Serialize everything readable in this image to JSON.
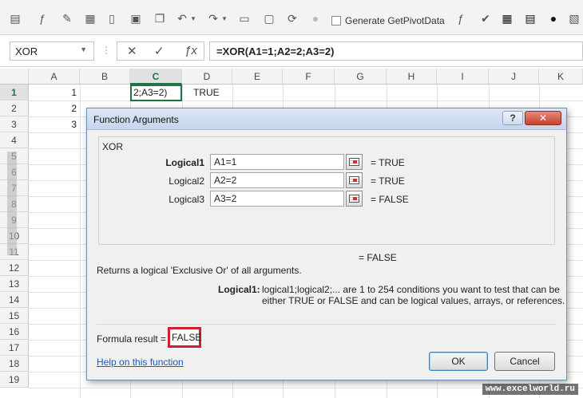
{
  "toolbar": {
    "generate_pivot_label": "Generate GetPivotData"
  },
  "formula_bar": {
    "name_box": "XOR",
    "formula": "=XOR(A1=1;A2=2;A3=2)"
  },
  "grid": {
    "columns": [
      "A",
      "B",
      "C",
      "D",
      "E",
      "F",
      "G",
      "H",
      "I",
      "J",
      "K"
    ],
    "rows": [
      "1",
      "2",
      "3",
      "4",
      "5",
      "6",
      "7",
      "8",
      "9",
      "10",
      "11",
      "12",
      "13",
      "14",
      "15",
      "16",
      "17",
      "18",
      "19"
    ],
    "cells": {
      "A1": "1",
      "A2": "2",
      "A3": "3",
      "C1": "2;A3=2)",
      "D1": "TRUE"
    }
  },
  "dialog": {
    "title": "Function Arguments",
    "help_button": "?",
    "close_button": "✕",
    "function_name": "XOR",
    "args": [
      {
        "label": "Logical1",
        "value": "A1=1",
        "result": "=  TRUE"
      },
      {
        "label": "Logical2",
        "value": "A2=2",
        "result": "=  TRUE"
      },
      {
        "label": "Logical3",
        "value": "A3=2",
        "result": "=  FALSE"
      }
    ],
    "overall_result": "=  FALSE",
    "description": "Returns a logical 'Exclusive Or' of all arguments.",
    "arg_help_label": "Logical1:",
    "arg_help_line1": "logical1;logical2;... are 1 to 254 conditions you want to test that can be",
    "arg_help_line2": "either TRUE or FALSE and can be logical values, arrays, or references.",
    "formula_result_label": "Formula result =",
    "formula_result_value": "FALSE",
    "help_link": "Help on this function",
    "ok_label": "OK",
    "cancel_label": "Cancel"
  },
  "watermark": "www.excelworld.ru"
}
